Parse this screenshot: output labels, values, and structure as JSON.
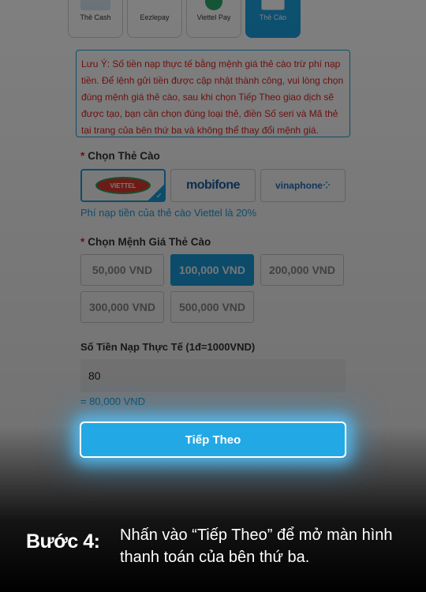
{
  "payment_methods": [
    {
      "label": "Thẻ Cash",
      "icon": "cash-card-icon",
      "active": false
    },
    {
      "label": "Eezlepay",
      "icon": "eezlepay-icon",
      "active": false
    },
    {
      "label": "Viettel Pay",
      "icon": "viettel-pay-icon",
      "active": false
    },
    {
      "label": "Thẻ Cào",
      "icon": "scratch-card-icon",
      "active": true
    }
  ],
  "notice": "Lưu Ý: Số tiền nạp thực tế bằng mệnh giá thẻ cào trừ phí nạp tiền. Để lệnh gửi tiền được cập nhật thành công, vui lòng chọn đúng mệnh giá thẻ cào, sau khi chọn Tiếp Theo giao dịch sẽ được tạo, bạn cần chọn đúng loại thẻ, điền Số seri và Mã thẻ tại trang của bên thứ ba và không thể thay đổi mệnh giá.",
  "carrier_section": {
    "required_mark": "*",
    "label": "Chọn Thẻ Cào"
  },
  "carriers": [
    {
      "name": "viettel",
      "logo_text": "VIETTEL",
      "selected": true
    },
    {
      "name": "mobifone",
      "logo_text": "mobifone",
      "selected": false
    },
    {
      "name": "vinaphone",
      "logo_text": "vinaphone",
      "selected": false
    }
  ],
  "fee_text": "Phí nạp tiền của thẻ cào Viettel là 20%",
  "denom_section": {
    "required_mark": "*",
    "label": "Chọn Mệnh Giá Thẻ Cào"
  },
  "denominations": [
    {
      "label": "50,000 VND",
      "selected": false
    },
    {
      "label": "100,000 VND",
      "selected": true
    },
    {
      "label": "200,000 VND",
      "selected": false
    },
    {
      "label": "300,000 VND",
      "selected": false
    },
    {
      "label": "500,000 VND",
      "selected": false
    }
  ],
  "amount": {
    "label": "Số Tiền Nạp Thực Tế (1đ=1000VND)",
    "value": "80",
    "converted": "= 80,000 VND"
  },
  "next_button": "Tiếp Theo",
  "caption": {
    "step": "Bước 4:",
    "instruction": "Nhấn vào “Tiếp Theo” để mở màn hình thanh toán của bên thứ ba."
  },
  "colors": {
    "accent": "#1aa0e0",
    "warning": "#e02020",
    "overlay": "#000000"
  }
}
